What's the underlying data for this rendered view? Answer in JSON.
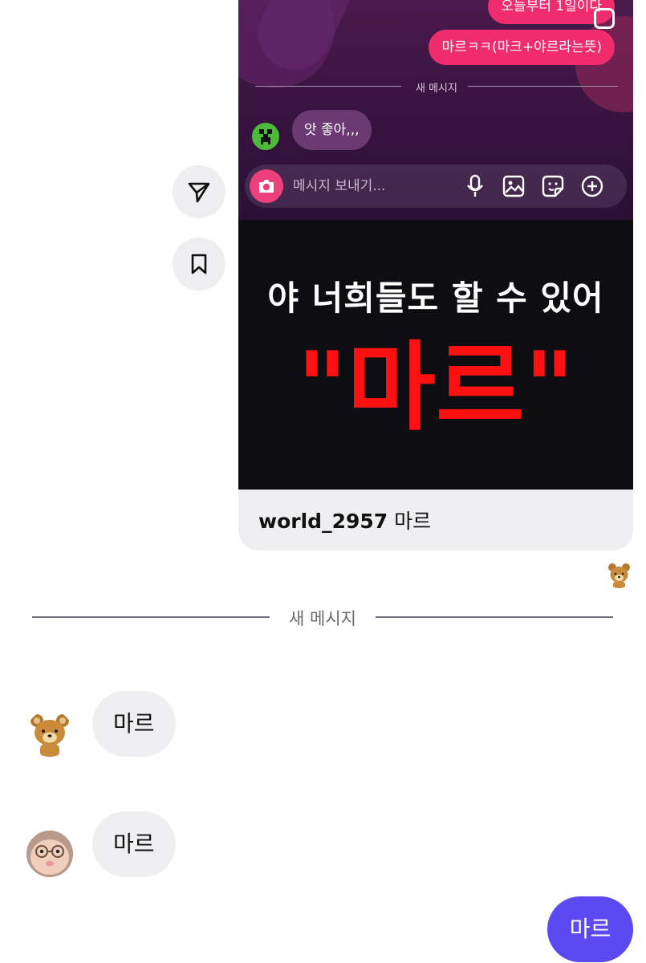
{
  "shared_post": {
    "screenshot": {
      "messages_sent": [
        "오늘부터 1일이다",
        "마르ㅋㅋ(마크+야르라는뜻)"
      ],
      "divider_label": "새 메시지",
      "reply_text": "앗 좋아,,,",
      "composer_placeholder": "메시지 보내기..."
    },
    "thumbnail": {
      "headline": "야 너희들도 할 수 있어",
      "big_text": "\"마르\""
    },
    "caption": {
      "username": "world_2957",
      "text": "마르"
    }
  },
  "divider": {
    "label": "새 메시지"
  },
  "messages": [
    {
      "text": "마르",
      "sender": "incoming"
    },
    {
      "text": "마르",
      "sender": "incoming"
    },
    {
      "text": "마르",
      "sender": "outgoing"
    }
  ],
  "colors": {
    "outgoing_bubble": "#5b4af2",
    "incoming_bubble": "#efeff2",
    "thumb_text_red": "#ff1010",
    "post_bubble_pink": "#ee2c6e"
  },
  "icons": {
    "share": "send-icon",
    "save": "bookmark-icon"
  }
}
